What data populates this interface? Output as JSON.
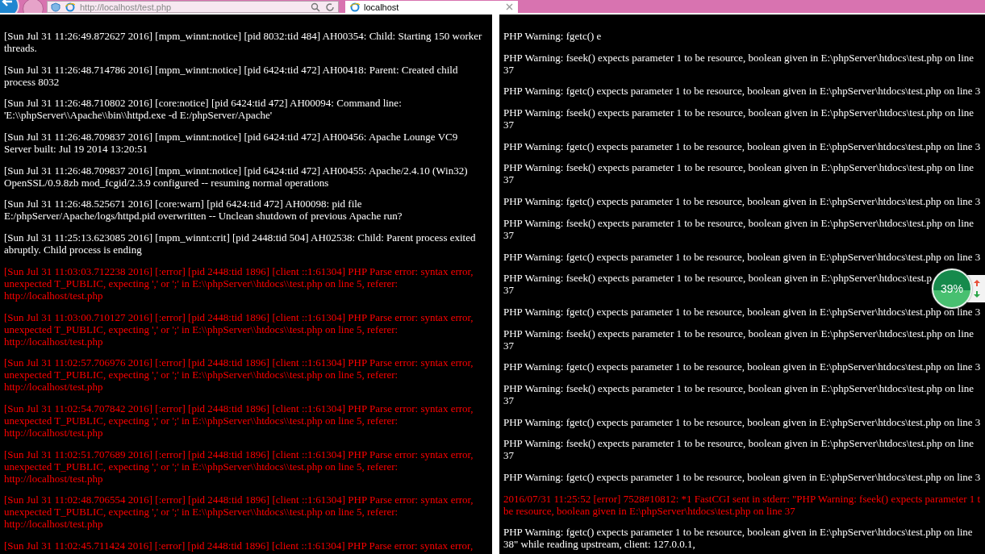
{
  "browser": {
    "address": "http://localhost/test.php",
    "tabs": [
      {
        "title": "localhost",
        "selected": true
      }
    ]
  },
  "panels": [
    {
      "entries": [
        {
          "kind": "normal",
          "lines": [
            "[Sun Jul 31 11:26:49.872627 2016] [mpm_winnt:notice] [pid 8032:tid 484] AH00354: Child: Starting 150 worker",
            "threads."
          ]
        },
        {
          "kind": "normal",
          "lines": [
            "[Sun Jul 31 11:26:48.714786 2016] [mpm_winnt:notice] [pid 6424:tid 472] AH00418: Parent: Created child",
            "process 8032"
          ]
        },
        {
          "kind": "normal",
          "lines": [
            "[Sun Jul 31 11:26:48.710802 2016] [core:notice] [pid 6424:tid 472] AH00094: Command line:",
            "'E:\\\\phpServer\\\\Apache\\\\bin\\\\httpd.exe -d E:/phpServer/Apache'"
          ]
        },
        {
          "kind": "normal",
          "lines": [
            "[Sun Jul 31 11:26:48.709837 2016] [mpm_winnt:notice] [pid 6424:tid 472] AH00456: Apache Lounge VC9",
            "Server built: Jul 19 2014 13:20:51"
          ]
        },
        {
          "kind": "normal",
          "lines": [
            "[Sun Jul 31 11:26:48.709837 2016] [mpm_winnt:notice] [pid 6424:tid 472] AH00455: Apache/2.4.10 (Win32)",
            "OpenSSL/0.9.8zb mod_fcgid/2.3.9 configured -- resuming normal operations"
          ]
        },
        {
          "kind": "normal",
          "lines": [
            "[Sun Jul 31 11:26:48.525671 2016] [core:warn] [pid 6424:tid 472] AH00098: pid file",
            "E:/phpServer/Apache/logs/httpd.pid overwritten -- Unclean shutdown of previous Apache run?"
          ]
        },
        {
          "kind": "normal",
          "lines": [
            "[Sun Jul 31 11:25:13.623085 2016] [mpm_winnt:crit] [pid 2448:tid 504] AH02538: Child: Parent process exited",
            "abruptly. Child process is ending"
          ]
        },
        {
          "kind": "error",
          "lines": [
            "[Sun Jul 31 11:03:03.712238 2016] [:error] [pid 2448:tid 1896] [client ::1:61304] PHP Parse error: syntax error,",
            "unexpected T_PUBLIC, expecting ',' or ';' in E:\\\\phpServer\\\\htdocs\\\\test.php on line 5, referer:",
            "http://localhost/test.php"
          ]
        },
        {
          "kind": "error",
          "lines": [
            "[Sun Jul 31 11:03:00.710127 2016] [:error] [pid 2448:tid 1896] [client ::1:61304] PHP Parse error: syntax error,",
            "unexpected T_PUBLIC, expecting ',' or ';' in E:\\\\phpServer\\\\htdocs\\\\test.php on line 5, referer:",
            "http://localhost/test.php"
          ]
        },
        {
          "kind": "error",
          "lines": [
            "[Sun Jul 31 11:02:57.706976 2016] [:error] [pid 2448:tid 1896] [client ::1:61304] PHP Parse error: syntax error,",
            "unexpected T_PUBLIC, expecting ',' or ';' in E:\\\\phpServer\\\\htdocs\\\\test.php on line 5, referer:",
            "http://localhost/test.php"
          ]
        },
        {
          "kind": "error",
          "lines": [
            "[Sun Jul 31 11:02:54.707842 2016] [:error] [pid 2448:tid 1896] [client ::1:61304] PHP Parse error: syntax error,",
            "unexpected T_PUBLIC, expecting ',' or ';' in E:\\\\phpServer\\\\htdocs\\\\test.php on line 5, referer:",
            "http://localhost/test.php"
          ]
        },
        {
          "kind": "error",
          "lines": [
            "[Sun Jul 31 11:02:51.707689 2016] [:error] [pid 2448:tid 1896] [client ::1:61304] PHP Parse error: syntax error,",
            "unexpected T_PUBLIC, expecting ',' or ';' in E:\\\\phpServer\\\\htdocs\\\\test.php on line 5, referer:",
            "http://localhost/test.php"
          ]
        },
        {
          "kind": "error",
          "lines": [
            "[Sun Jul 31 11:02:48.706554 2016] [:error] [pid 2448:tid 1896] [client ::1:61304] PHP Parse error: syntax error,",
            "unexpected T_PUBLIC, expecting ',' or ';' in E:\\\\phpServer\\\\htdocs\\\\test.php on line 5, referer:",
            "http://localhost/test.php"
          ]
        },
        {
          "kind": "error",
          "lines": [
            "[Sun Jul 31 11:02:45.711424 2016] [:error] [pid 2448:tid 1896] [client ::1:61304] PHP Parse error: syntax error,"
          ]
        }
      ]
    },
    {
      "entries": [
        {
          "kind": "normal",
          "lines": [
            "PHP Warning: fgetc() e"
          ]
        },
        {
          "kind": "normal",
          "lines": [
            "PHP Warning: fseek() expects parameter 1 to be resource, boolean given in E:\\phpServer\\htdocs\\test.php on line",
            "37"
          ]
        },
        {
          "kind": "normal",
          "lines": [
            "PHP Warning: fgetc() expects parameter 1 to be resource, boolean given in E:\\phpServer\\htdocs\\test.php on line 3"
          ]
        },
        {
          "kind": "normal",
          "lines": [
            "PHP Warning: fseek() expects parameter 1 to be resource, boolean given in E:\\phpServer\\htdocs\\test.php on line",
            "37"
          ]
        },
        {
          "kind": "normal",
          "lines": [
            "PHP Warning: fgetc() expects parameter 1 to be resource, boolean given in E:\\phpServer\\htdocs\\test.php on line 3"
          ]
        },
        {
          "kind": "normal",
          "lines": [
            "PHP Warning: fseek() expects parameter 1 to be resource, boolean given in E:\\phpServer\\htdocs\\test.php on line",
            "37"
          ]
        },
        {
          "kind": "normal",
          "lines": [
            "PHP Warning: fgetc() expects parameter 1 to be resource, boolean given in E:\\phpServer\\htdocs\\test.php on line 3"
          ]
        },
        {
          "kind": "normal",
          "lines": [
            "PHP Warning: fseek() expects parameter 1 to be resource, boolean given in E:\\phpServer\\htdocs\\test.php on line",
            "37"
          ]
        },
        {
          "kind": "normal",
          "lines": [
            "PHP Warning: fgetc() expects parameter 1 to be resource, boolean given in E:\\phpServer\\htdocs\\test.php on line 3"
          ]
        },
        {
          "kind": "normal",
          "lines": [
            "PHP Warning: fseek() expects parameter 1 to be resource, boolean given in E:\\phpServer\\htdocs\\test.p",
            "37"
          ]
        },
        {
          "kind": "normal",
          "lines": [
            "PHP Warning: fgetc() expects parameter 1 to be resource, boolean given in E:\\phpServer\\htdocs\\test.php on line 3"
          ]
        },
        {
          "kind": "normal",
          "lines": [
            "PHP Warning: fseek() expects parameter 1 to be resource, boolean given in E:\\phpServer\\htdocs\\test.php on line",
            "37"
          ]
        },
        {
          "kind": "normal",
          "lines": [
            "PHP Warning: fgetc() expects parameter 1 to be resource, boolean given in E:\\phpServer\\htdocs\\test.php on line 3"
          ]
        },
        {
          "kind": "normal",
          "lines": [
            "PHP Warning: fseek() expects parameter 1 to be resource, boolean given in E:\\phpServer\\htdocs\\test.php on line",
            "37"
          ]
        },
        {
          "kind": "normal",
          "lines": [
            "PHP Warning: fgetc() expects parameter 1 to be resource, boolean given in E:\\phpServer\\htdocs\\test.php on line 3"
          ]
        },
        {
          "kind": "normal",
          "lines": [
            "PHP Warning: fseek() expects parameter 1 to be resource, boolean given in E:\\phpServer\\htdocs\\test.php on line",
            "37"
          ]
        },
        {
          "kind": "normal",
          "lines": [
            "PHP Warning: fgetc() expects parameter 1 to be resource, boolean given in E:\\phpServer\\htdocs\\test.php on line 3"
          ]
        },
        {
          "kind": "error",
          "lines": [
            "2016/07/31 11:25:52 [error] 7528#10812: *1 FastCGI sent in stderr: \"PHP Warning: fseek() expects parameter 1 t",
            "be resource, boolean given in E:\\phpServer\\htdocs\\test.php on line 37"
          ]
        },
        {
          "kind": "normal",
          "lines": [
            "PHP Warning: fgetc() expects parameter 1 to be resource, boolean given in E:\\phpServer\\htdocs\\test.php on line",
            "38\" while reading upstream, client: 127.0.0.1,"
          ]
        }
      ]
    }
  ],
  "widget": {
    "percent": "39%"
  }
}
